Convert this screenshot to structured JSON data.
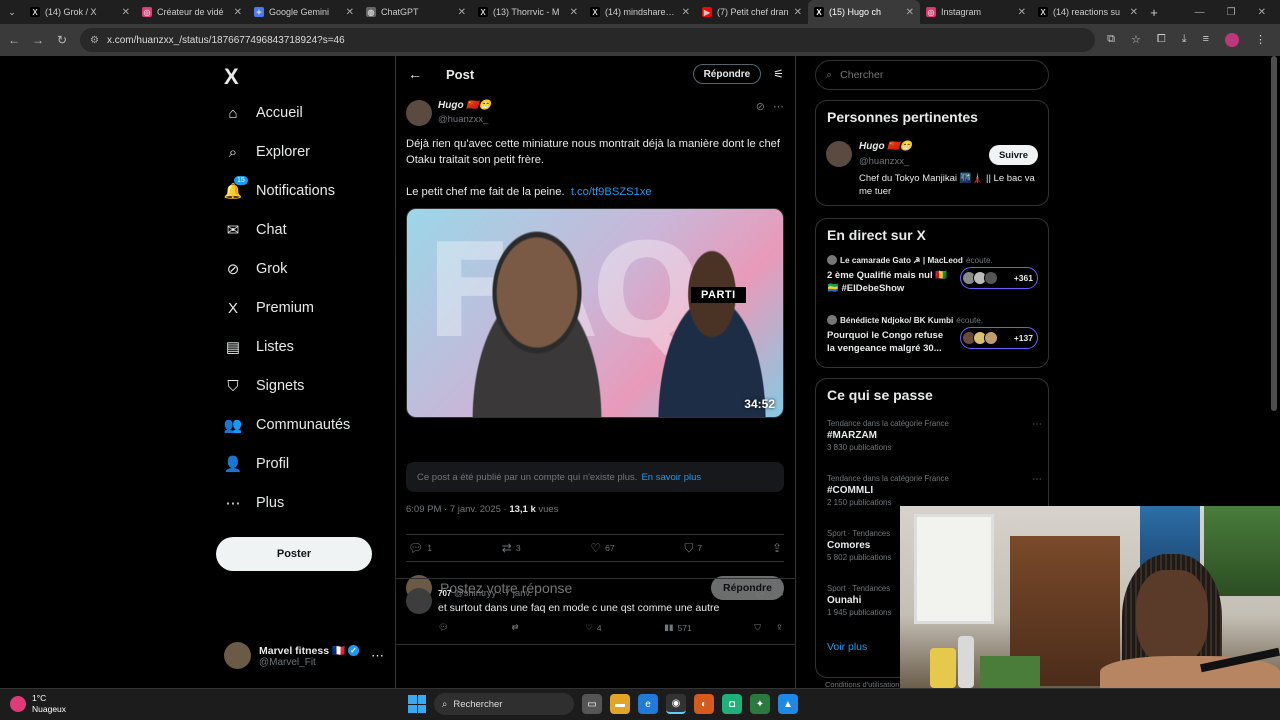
{
  "browser": {
    "tabs": [
      {
        "label": "(14) Grok / X",
        "icon": "X",
        "color": "#000000",
        "active": false
      },
      {
        "label": "Créateur de vidé",
        "icon": "◎",
        "color": "#e13a7a",
        "active": false
      },
      {
        "label": "Google Gemini",
        "icon": "✦",
        "color": "#4b7bec",
        "active": false
      },
      {
        "label": "ChatGPT",
        "icon": "◍",
        "color": "#666666",
        "active": false
      },
      {
        "label": "(13) Thorrvic - M",
        "icon": "X",
        "color": "#000000",
        "active": false
      },
      {
        "label": "(14) mindshare su",
        "icon": "X",
        "color": "#000000",
        "active": false
      },
      {
        "label": "(7) Petit chef dran",
        "icon": "▶",
        "color": "#ff0000",
        "active": false
      },
      {
        "label": "(15) Hugo ch",
        "icon": "X",
        "color": "#000000",
        "active": true
      },
      {
        "label": "Instagram",
        "icon": "◎",
        "color": "#e1306c",
        "active": false
      },
      {
        "label": "(14) reactions su",
        "icon": "X",
        "color": "#000000",
        "active": false
      }
    ],
    "url": "x.com/huanzxx_/status/1876677496843718924?s=46"
  },
  "nav": {
    "logo": "X",
    "items": [
      {
        "label": "Accueil",
        "icon": "⌂"
      },
      {
        "label": "Explorer",
        "icon": "⌕"
      },
      {
        "label": "Notifications",
        "icon": "🔔",
        "badge": "15"
      },
      {
        "label": "Chat",
        "icon": "✉"
      },
      {
        "label": "Grok",
        "icon": "⊘"
      },
      {
        "label": "Premium",
        "icon": "X"
      },
      {
        "label": "Listes",
        "icon": "▤"
      },
      {
        "label": "Signets",
        "icon": "⛉"
      },
      {
        "label": "Communautés",
        "icon": "👥"
      },
      {
        "label": "Profil",
        "icon": "👤"
      },
      {
        "label": "Plus",
        "icon": "⋯"
      }
    ],
    "post_button": "Poster",
    "account": {
      "name": "Marvel fitness 🇫🇷",
      "handle": "@Marvel_Fit"
    }
  },
  "main": {
    "header_title": "Post",
    "reply_pill": "Répondre",
    "post": {
      "author_name": "Hugo 🇨🇳😁",
      "author_handle": "@huanzxx_",
      "text_line1": "Déjà rien qu'avec cette miniature nous montrait déjà la manière dont le chef Otaku traitait son petit frère.",
      "text_line2": "Le petit chef me fait de la peine.",
      "link": "t.co/tf9BSZS1xe",
      "thumb_badge": "PARTI",
      "duration": "34:52",
      "notice": "Ce post a été publié par un compte qui n'existe plus.",
      "notice_link": "En savoir plus",
      "timestamp": "6:09 PM · 7 janv. 2025 · ",
      "views_count": "13,1 k",
      "views_label": " vues",
      "replies": "1",
      "reposts": "3",
      "likes": "67",
      "bookmarks": "7"
    },
    "compose": {
      "placeholder": "Postez votre réponse",
      "button": "Répondre"
    },
    "reply": {
      "name": "707",
      "handle": "@shintryy · 7 janv.",
      "text": "et surtout dans une faq en mode c une qst comme une autre",
      "reposts": "",
      "likes": "4",
      "views": "571"
    }
  },
  "sidebar": {
    "search_placeholder": "Chercher",
    "relevant": {
      "title": "Personnes pertinentes",
      "name": "Hugo 🇨🇳😁",
      "handle": "@huanzxx_",
      "bio": "Chef du Tokyo Manjikai 🌃🗼 || Le bac va me tuer",
      "follow": "Suivre"
    },
    "live": {
      "title": "En direct sur X",
      "spaces": [
        {
          "host": "Le camarade Gato ☭ | MacLeod",
          "state": "écoute.",
          "title": "2 ème Qualifié mais nul 🇬🇳🇬🇦 #ElDebeShow",
          "count": "+361"
        },
        {
          "host": "Bénédicte Ndjoko/ BK Kumbi",
          "state": "écoute.",
          "title": "Pourquoi le Congo refuse la vengeance malgré 30...",
          "count": "+137"
        }
      ]
    },
    "trends": {
      "title": "Ce qui se passe",
      "items": [
        {
          "category": "Tendance dans la catégorie France",
          "name": "#MARZAM",
          "posts": "3 830 publications"
        },
        {
          "category": "Tendance dans la catégorie France",
          "name": "#COMMLI",
          "posts": "2 150 publications"
        },
        {
          "category": "Sport · Tendances",
          "name": "Comores",
          "posts": "5 802 publications"
        },
        {
          "category": "Sport · Tendances",
          "name": "Ounahi",
          "posts": "1 945 publications"
        }
      ],
      "see_more": "Voir plus"
    },
    "conditions": "Conditions d'utilisation"
  },
  "taskbar": {
    "temp": "1°C",
    "weather": "Nuageux",
    "search": "Rechercher"
  }
}
